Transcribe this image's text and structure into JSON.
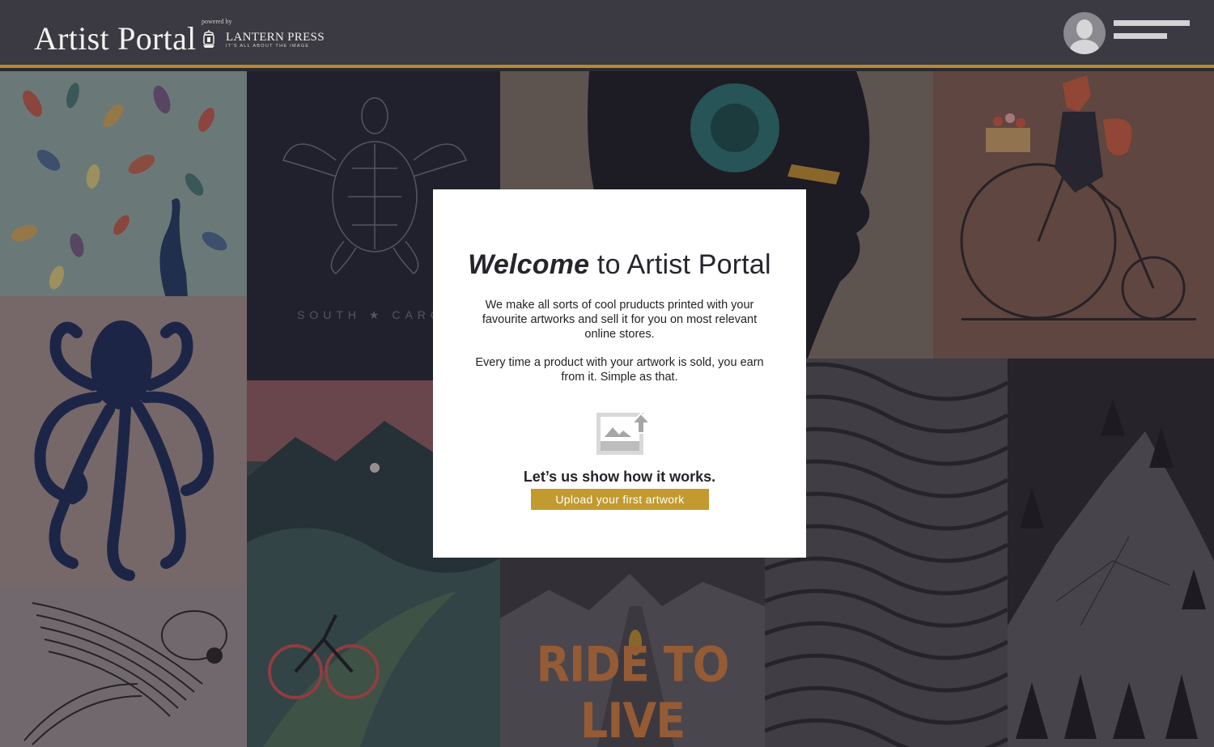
{
  "header": {
    "app_title": "Artist Portal",
    "powered_by": "powered by",
    "partner_name": "LANTERN PRESS",
    "partner_tagline": "IT'S ALL ABOUT THE IMAGE"
  },
  "background": {
    "turtle_caption": "SOUTH ★ CAROLI",
    "poster_caption": "RIDE TO LIVE"
  },
  "modal": {
    "title_emphasis": "Welcome",
    "title_rest": " to Artist Portal",
    "paragraph_1": "We make all sorts of cool pruducts printed with your favourite artworks and sell it for you on most relevant online stores.",
    "paragraph_2": "Every time a product with your artwork is sold, you earn from it. Simple as that.",
    "cta_heading": "Let’s us show how it works.",
    "upload_button_label": "Upload your first artwork"
  },
  "colors": {
    "header_bg": "#3b3a43",
    "accent_gold": "#c39a2f",
    "modal_bg": "#ffffff"
  },
  "icons": [
    "lantern-icon",
    "avatar-icon",
    "image-upload-icon"
  ]
}
